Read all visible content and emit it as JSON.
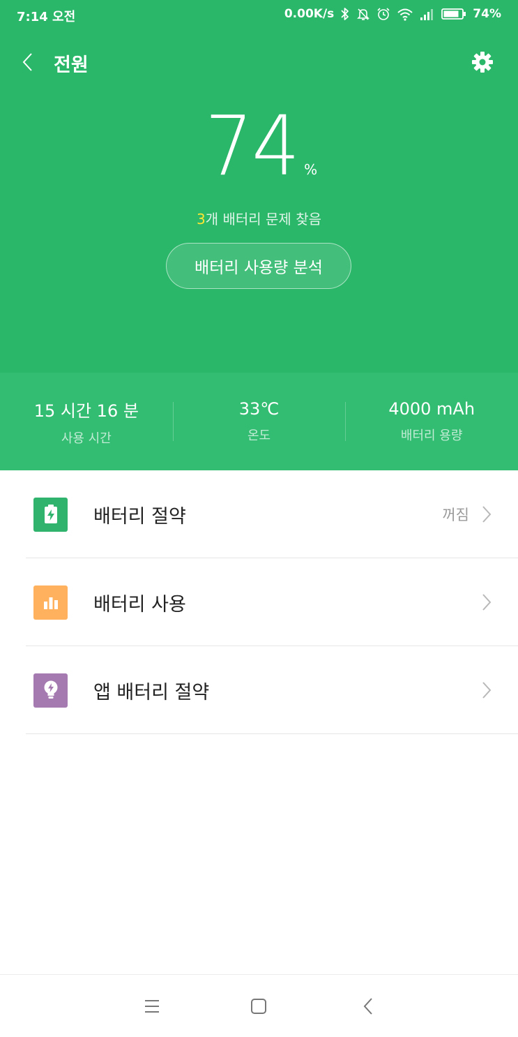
{
  "status_bar": {
    "time": "7:14 오전",
    "net_speed": "0.00K/s",
    "battery": "74%",
    "icons": [
      "bluetooth-icon",
      "bell-off-icon",
      "alarm-icon",
      "wifi-icon",
      "signal-icon",
      "battery-icon"
    ]
  },
  "header": {
    "title": "전원",
    "back_icon": "chevron-left-icon",
    "settings_icon": "gear-icon"
  },
  "battery": {
    "level": "74",
    "unit": "%",
    "issues_count": "3",
    "issues_text": "개 배터리 문제 찾음",
    "analyze_button": "배터리 사용량 분석"
  },
  "stats": [
    {
      "value": "15 시간 16 분",
      "label": "사용 시간"
    },
    {
      "value": "33℃",
      "label": "온도"
    },
    {
      "value": "4000 mAh",
      "label": "배터리 용량"
    }
  ],
  "menu": [
    {
      "label": "배터리 절약",
      "value": "꺼짐",
      "icon": "battery-charge-icon",
      "color": "#2fb36d"
    },
    {
      "label": "배터리 사용",
      "value": "",
      "icon": "bar-chart-icon",
      "color": "#ffb15e"
    },
    {
      "label": "앱 배터리 절약",
      "value": "",
      "icon": "lightbulb-icon",
      "color": "#a57ab0"
    }
  ],
  "colors": {
    "primary": "#2ab769",
    "stats_bg": "#33bd72",
    "highlight": "#ffe633"
  },
  "nav": [
    "menu-icon",
    "home-icon",
    "back-icon"
  ]
}
